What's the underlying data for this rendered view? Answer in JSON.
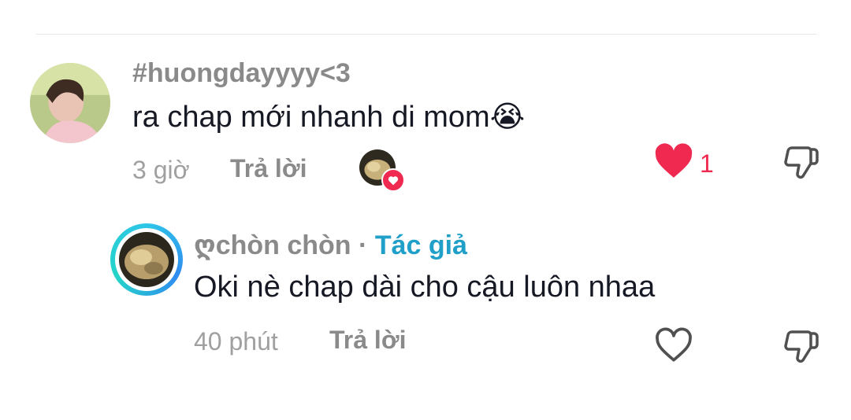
{
  "comment": {
    "username": "#huongdayyyy<3",
    "text": "ra chap mới nhanh di mom",
    "emoji": "😭",
    "time": "3 giờ",
    "reply_label": "Trả lời",
    "like_count": "1",
    "liked": true
  },
  "reply": {
    "username": "ღchòn chòn",
    "separator": "·",
    "author_badge": "Tác giả",
    "text": "Oki nè chap dài cho cậu luôn nhaa",
    "time": "40 phút",
    "reply_label": "Trả lời",
    "liked": false
  },
  "colors": {
    "like_red": "#ef2950",
    "author_blue": "#20a0c8",
    "meta_gray": "#a0a0a0"
  },
  "icons": {
    "like": "heart-icon",
    "dislike": "thumbs-down-icon",
    "liker": "creator-liked-heart-icon"
  }
}
